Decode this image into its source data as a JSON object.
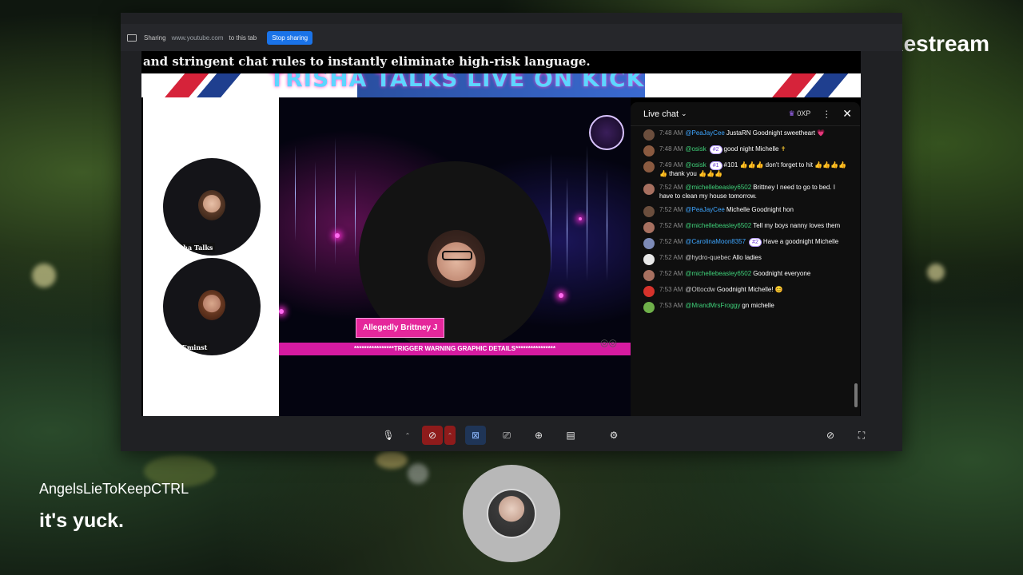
{
  "share_bar": {
    "sharing_label": "Sharing",
    "url": "www.youtube.com",
    "suffix": "to this tab",
    "stop_button": "Stop sharing"
  },
  "stream": {
    "caption": "and stringent chat rules to instantly eliminate high-risk language.",
    "banner_title": "TRISHA TALKS LIVE ON KICK",
    "guests": [
      {
        "label": "Trisha Talks"
      },
      {
        "label": "CLIEminst"
      }
    ],
    "name_tag": "Allegedly Brittney J",
    "warning": "****************TRIGGER WARNING GRAPHIC DETAILS****************"
  },
  "chat": {
    "title": "Live chat",
    "xp": "0XP",
    "messages": [
      {
        "time": "7:48 AM",
        "user": "@PeaJayCee",
        "text": "JustaRN Goodnight sweetheart",
        "emoji": "💗",
        "color": "blue",
        "avatar": "#6b4e3d"
      },
      {
        "time": "7:48 AM",
        "user": "@osisk",
        "badge": "#2",
        "text": "good night Michelle",
        "emoji": "✝",
        "color": "green",
        "avatar": "#8a5a40"
      },
      {
        "time": "7:49 AM",
        "user": "@osisk",
        "badge": "#1",
        "text": "#101 👍👍👍 don't forget to hit 👍👍👍👍👍 thank you 👍👍👍",
        "color": "green",
        "avatar": "#8a5a40"
      },
      {
        "time": "7:52 AM",
        "user": "@michellebeasley6502",
        "text": "Brittney I need to go to bed. I have to clean my house tomorrow.",
        "color": "green",
        "avatar": "#a77060"
      },
      {
        "time": "7:52 AM",
        "user": "@PeaJayCee",
        "text": "Michelle Goodnight hon",
        "color": "blue",
        "avatar": "#6b4e3d"
      },
      {
        "time": "7:52 AM",
        "user": "@michellebeasley6502",
        "text": "Tell my boys nanny loves them",
        "color": "green",
        "avatar": "#a77060"
      },
      {
        "time": "7:52 AM",
        "user": "@CarolinaMoon8357",
        "badge": "#2",
        "text": "Have a goodnight Michelle",
        "color": "blue",
        "avatar": "#7d8bb8"
      },
      {
        "time": "7:52 AM",
        "user": "@hydro-quebec",
        "text": "Allo ladies",
        "color": "plain",
        "avatar": "#e8e8e8"
      },
      {
        "time": "7:52 AM",
        "user": "@michellebeasley6502",
        "text": "Goodnight everyone",
        "color": "green",
        "avatar": "#a77060"
      },
      {
        "time": "7:53 AM",
        "user": "@Ottocdw",
        "text": "Goodnight Michelle!",
        "emoji": "😊",
        "color": "plain",
        "avatar": "#d6322b"
      },
      {
        "time": "7:53 AM",
        "user": "@MrandMrsFroggy",
        "text": "gn michelle",
        "color": "green",
        "avatar": "#6fb04a"
      }
    ]
  },
  "overlay": {
    "brand": "Restream",
    "commenter": "AngelsLieToKeepCTRL",
    "comment": "it's yuck."
  },
  "colors": {
    "accent_pink": "#e5279b",
    "stop_blue": "#1a73e8",
    "chat_bg": "#0f0f0f"
  }
}
